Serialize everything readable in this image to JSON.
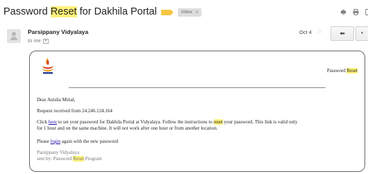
{
  "header": {
    "subject_pre": "Password ",
    "subject_highlight": "Reset",
    "subject_post": " for Dakhila Portal",
    "label_chip": "Inbox",
    "label_chip_close": "x",
    "icons": [
      "label-icon",
      "print-icon",
      "open-in-new-icon"
    ]
  },
  "message": {
    "sender": "Parsippany Vidyalaya",
    "to": "to me",
    "date": "Oct 4",
    "star_glyph": "☆",
    "reply_glyph": "⬅",
    "more_glyph": "▼"
  },
  "email": {
    "header_pre": "Password ",
    "header_highlight": "Reset",
    "greeting": "Dear Anisha Mittal,",
    "request_line": "Request received from 24.246.124.164",
    "body_1": "Click ",
    "link_here": "here",
    "body_2": " to set your password for Dakhila Portal at Vidyalaya. Follow the instructions to ",
    "body_reset": "reset",
    "body_3": " your password. This link is valid only",
    "body_line2_pre": "for 1 hour and on the same machine. It will ",
    "body_not": "not",
    "body_line2_post": " work after one hour or from another location.",
    "login_pre": "Please ",
    "link_login": "login",
    "login_post": " again with the new password",
    "sig_name": "Parsippany Vidyalaya",
    "sig_sent_pre": "sent by: Password ",
    "sig_sent_highlight": "Reset",
    "sig_sent_post": " Program"
  },
  "colors": {
    "highlight": "#fff27a",
    "label_tag": "#f6c642",
    "link": "#1a0dab"
  }
}
